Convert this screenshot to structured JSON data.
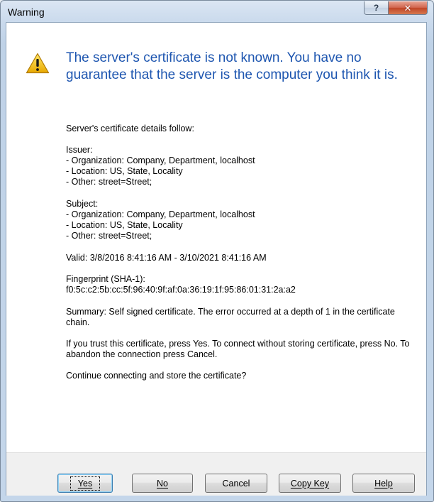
{
  "window": {
    "title": "Warning",
    "help_glyph": "?",
    "close_glyph": "✕"
  },
  "icon": {
    "name": "warning-icon",
    "color": "#f5c400"
  },
  "headline": "The server's certificate is not known. You have no guarantee that the server is the computer you think it is.",
  "details": {
    "intro": "Server's certificate details follow:",
    "issuer": {
      "label": "Issuer:",
      "organization": "- Organization: Company, Department, localhost",
      "location": "- Location: US, State, Locality",
      "other": "- Other: street=Street;"
    },
    "subject": {
      "label": "Subject:",
      "organization": "- Organization: Company, Department, localhost",
      "location": "- Location: US, State, Locality",
      "other": "- Other: street=Street;"
    },
    "valid": "Valid: 3/8/2016 8:41:16 AM - 3/10/2021 8:41:16 AM",
    "fingerprint_label": "Fingerprint (SHA-1):",
    "fingerprint_value": "f0:5c:c2:5b:cc:5f:96:40:9f:af:0a:36:19:1f:95:86:01:31:2a:a2",
    "summary": "Summary: Self signed certificate. The error occurred at a depth of 1 in the certificate chain.",
    "instructions": "If you trust this certificate, press Yes. To connect without storing certificate, press No. To abandon the connection press Cancel.",
    "question": "Continue connecting and store the certificate?"
  },
  "buttons": {
    "yes": "Yes",
    "no": "No",
    "cancel": "Cancel",
    "copy_key": "Copy Key",
    "help": "Help"
  }
}
